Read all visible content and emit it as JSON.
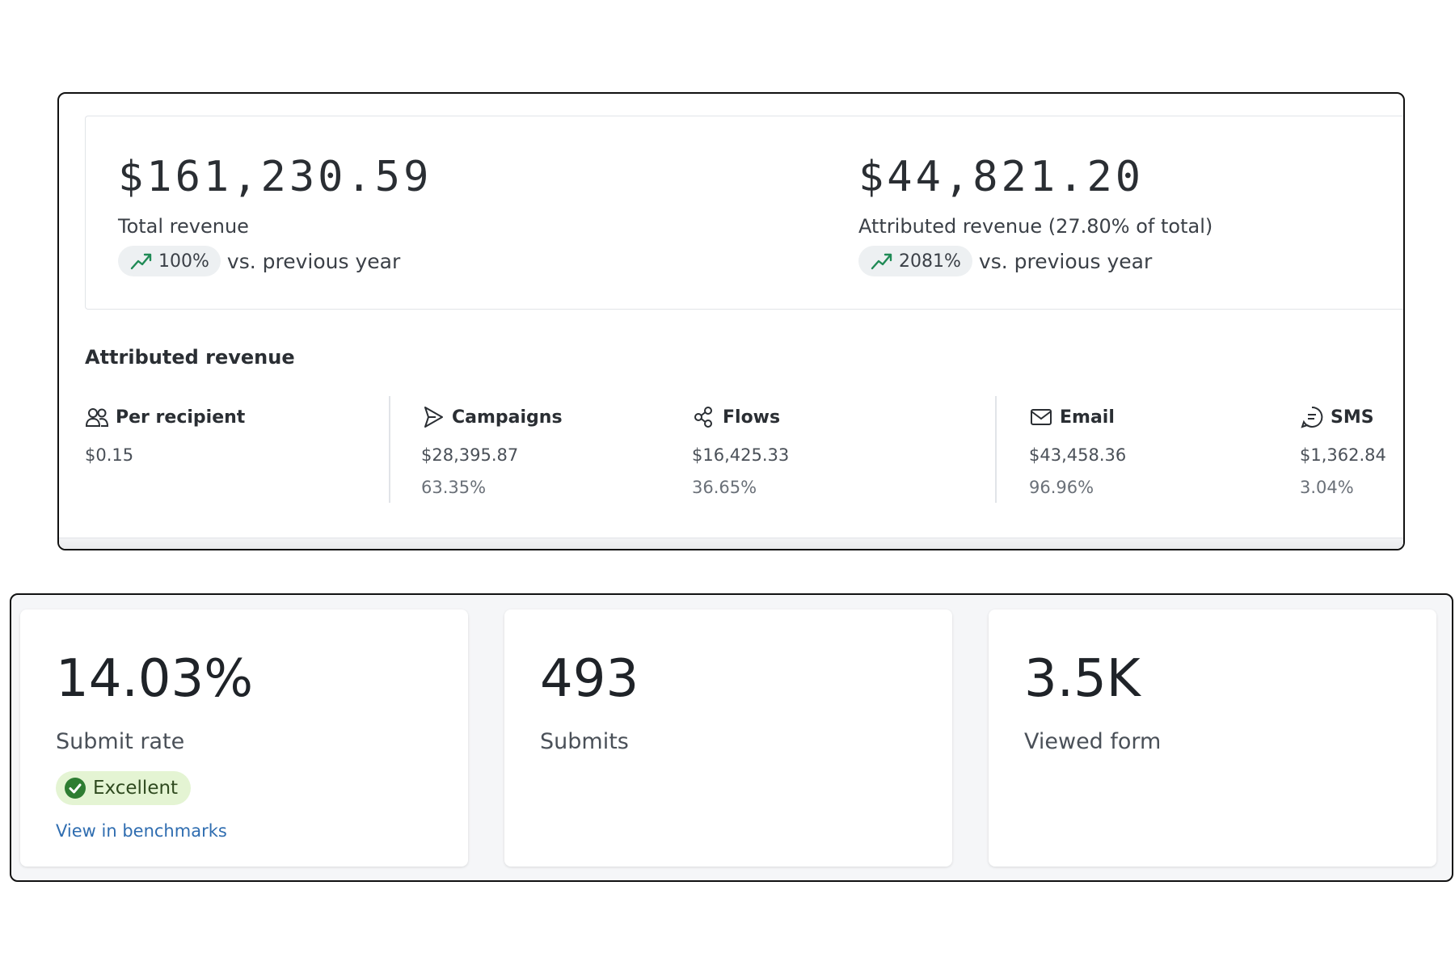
{
  "revenue": {
    "total": {
      "amount": "$161,230.59",
      "label": "Total revenue",
      "change": "100%",
      "comparison": "vs. previous year"
    },
    "attributed": {
      "amount": "$44,821.20",
      "label": "Attributed revenue (27.80% of total)",
      "change": "2081%",
      "comparison": "vs. previous year"
    },
    "section_title": "Attributed revenue",
    "columns": [
      {
        "icon": "users-icon",
        "label": "Per recipient",
        "value": "$0.15",
        "percent": ""
      },
      {
        "icon": "send-icon",
        "label": "Campaigns",
        "value": "$28,395.87",
        "percent": "63.35%"
      },
      {
        "icon": "flows-icon",
        "label": "Flows",
        "value": "$16,425.33",
        "percent": "36.65%"
      },
      {
        "icon": "mail-icon",
        "label": "Email",
        "value": "$43,458.36",
        "percent": "96.96%"
      },
      {
        "icon": "sms-icon",
        "label": "SMS",
        "value": "$1,362.84",
        "percent": "3.04%"
      }
    ],
    "trend_color": "#1f8a55"
  },
  "form_stats": {
    "cards": [
      {
        "value": "14.03%",
        "label": "Submit rate",
        "badge": "Excellent",
        "link": "View in benchmarks"
      },
      {
        "value": "493",
        "label": "Submits"
      },
      {
        "value": "3.5K",
        "label": "Viewed form"
      }
    ],
    "badge_color": "#2e7d32",
    "link_color": "#2f6db0"
  }
}
